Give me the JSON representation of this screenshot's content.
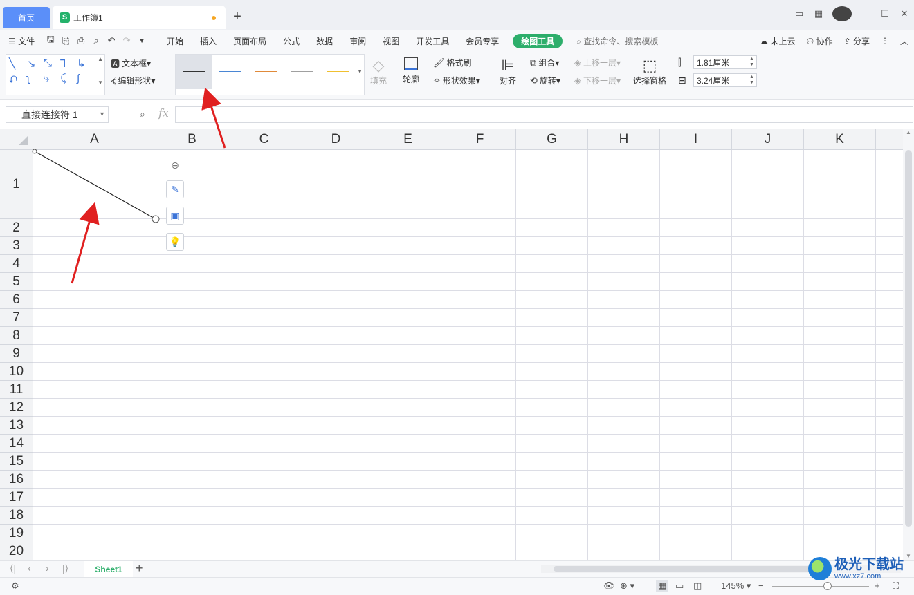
{
  "tabs": {
    "home": "首页",
    "document": "工作簿1",
    "doc_icon": "S",
    "new_tab": "+"
  },
  "menu": {
    "file": "文件",
    "items": [
      "开始",
      "插入",
      "页面布局",
      "公式",
      "数据",
      "审阅",
      "视图",
      "开发工具",
      "会员专享"
    ],
    "draw_tools": "绘图工具",
    "search": "查找命令、搜索模板",
    "cloud": "未上云",
    "collab": "协作",
    "share": "分享"
  },
  "ribbon": {
    "text_box": "文本框",
    "edit_shape": "编辑形状",
    "fill": "填充",
    "outline": "轮廓",
    "format_painter": "格式刷",
    "shape_effect": "形状效果",
    "align": "对齐",
    "group": "组合",
    "rotate": "旋转",
    "bring_forward": "上移一层",
    "send_backward": "下移一层",
    "selection_pane": "选择窗格",
    "height": "1.81厘米",
    "width": "3.24厘米",
    "style_colors": [
      "#333333",
      "#4a86d4",
      "#e08a3a",
      "#a0a0a0",
      "#f0c030"
    ]
  },
  "formula": {
    "name_box": "直接连接符 1",
    "fx": "fx",
    "value": ""
  },
  "columns": [
    "A",
    "B",
    "C",
    "D",
    "E",
    "F",
    "G",
    "H",
    "I",
    "J",
    "K"
  ],
  "rows": [
    "1",
    "2",
    "3",
    "4",
    "5",
    "6",
    "7",
    "8",
    "9",
    "10",
    "11",
    "12",
    "13",
    "14",
    "15",
    "16",
    "17",
    "18",
    "19",
    "20"
  ],
  "sheets": {
    "active": "Sheet1",
    "add": "+"
  },
  "status": {
    "zoom": "145%"
  },
  "watermark": {
    "title": "极光下载站",
    "url": "www.xz7.com"
  },
  "accent": {
    "green": "#2dae6b",
    "blue": "#5b8ff9",
    "arrow": "#e02020"
  }
}
